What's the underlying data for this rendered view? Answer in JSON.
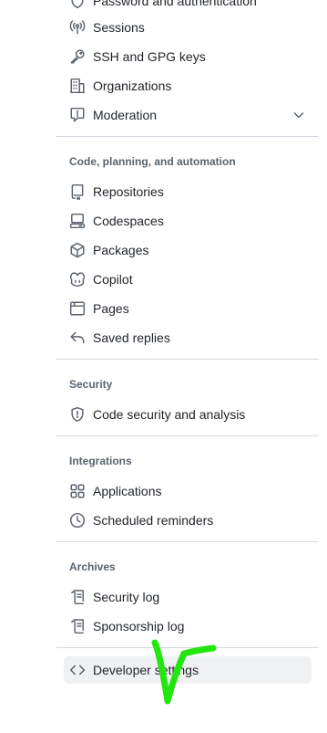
{
  "sidebar": {
    "top_items": [
      {
        "label": "Password and authentication",
        "icon": "shield-lock-icon"
      },
      {
        "label": "Sessions",
        "icon": "broadcast-icon"
      },
      {
        "label": "SSH and GPG keys",
        "icon": "key-icon"
      },
      {
        "label": "Organizations",
        "icon": "organization-icon"
      },
      {
        "label": "Moderation",
        "icon": "report-icon"
      }
    ],
    "sections": [
      {
        "title": "Code, planning, and automation",
        "items": [
          {
            "label": "Repositories",
            "icon": "repo-icon"
          },
          {
            "label": "Codespaces",
            "icon": "codespaces-icon"
          },
          {
            "label": "Packages",
            "icon": "package-icon"
          },
          {
            "label": "Copilot",
            "icon": "copilot-icon"
          },
          {
            "label": "Pages",
            "icon": "browser-icon"
          },
          {
            "label": "Saved replies",
            "icon": "reply-icon"
          }
        ]
      },
      {
        "title": "Security",
        "items": [
          {
            "label": "Code security and analysis",
            "icon": "shield-icon"
          }
        ]
      },
      {
        "title": "Integrations",
        "items": [
          {
            "label": "Applications",
            "icon": "apps-icon"
          },
          {
            "label": "Scheduled reminders",
            "icon": "clock-icon"
          }
        ]
      },
      {
        "title": "Archives",
        "items": [
          {
            "label": "Security log",
            "icon": "log-icon"
          },
          {
            "label": "Sponsorship log",
            "icon": "log-icon"
          }
        ]
      }
    ],
    "bottom_item": {
      "label": "Developer settings",
      "icon": "code-icon"
    }
  },
  "colors": {
    "annotation": "#22e60e",
    "active_bg": "#f0f1f3"
  }
}
